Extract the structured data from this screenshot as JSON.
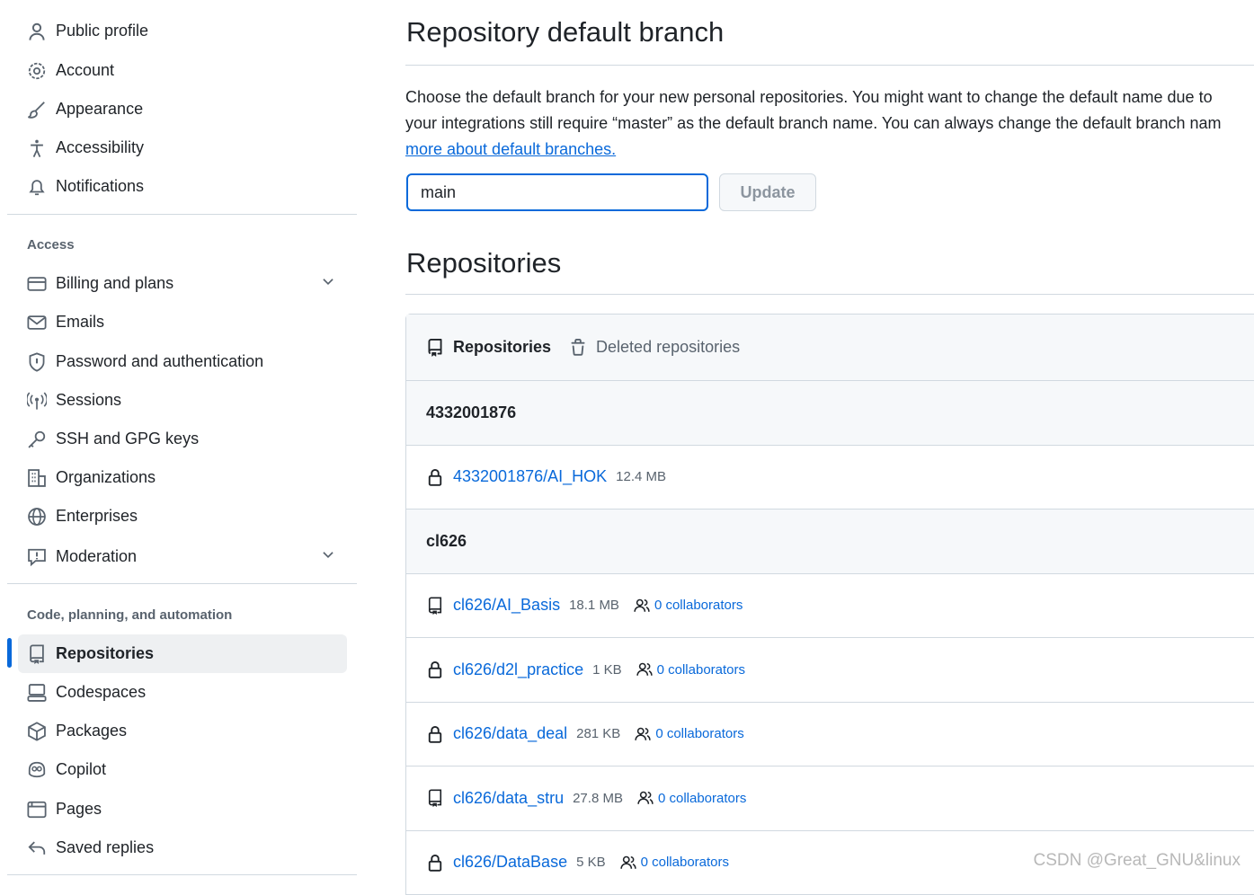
{
  "sidebar": {
    "items_top": [
      {
        "label": "Public profile",
        "icon": "person-icon"
      },
      {
        "label": "Account",
        "icon": "gear-icon"
      },
      {
        "label": "Appearance",
        "icon": "paintbrush-icon"
      },
      {
        "label": "Accessibility",
        "icon": "accessibility-icon"
      },
      {
        "label": "Notifications",
        "icon": "bell-icon"
      }
    ],
    "access_heading": "Access",
    "items_access": [
      {
        "label": "Billing and plans",
        "icon": "credit-card-icon",
        "expandable": true
      },
      {
        "label": "Emails",
        "icon": "mail-icon"
      },
      {
        "label": "Password and authentication",
        "icon": "shield-icon"
      },
      {
        "label": "Sessions",
        "icon": "broadcast-icon"
      },
      {
        "label": "SSH and GPG keys",
        "icon": "key-icon"
      },
      {
        "label": "Organizations",
        "icon": "organization-icon"
      },
      {
        "label": "Enterprises",
        "icon": "globe-icon"
      },
      {
        "label": "Moderation",
        "icon": "report-icon",
        "expandable": true
      }
    ],
    "code_heading": "Code, planning, and automation",
    "items_code": [
      {
        "label": "Repositories",
        "icon": "repo-icon",
        "selected": true
      },
      {
        "label": "Codespaces",
        "icon": "codespaces-icon"
      },
      {
        "label": "Packages",
        "icon": "package-icon"
      },
      {
        "label": "Copilot",
        "icon": "copilot-icon"
      },
      {
        "label": "Pages",
        "icon": "browser-icon"
      },
      {
        "label": "Saved replies",
        "icon": "reply-icon"
      }
    ]
  },
  "default_branch": {
    "title": "Repository default branch",
    "desc_line1": "Choose the default branch for your new personal repositories. You might want to change the default name due to",
    "desc_line2": "your integrations still require “master” as the default branch name. You can always change the default branch nam",
    "link": "more about default branches.",
    "input_value": "main",
    "update_label": "Update"
  },
  "repositories": {
    "title": "Repositories",
    "tabs": [
      "Repositories",
      "Deleted repositories"
    ],
    "groups": [
      {
        "owner": "4332001876",
        "repos": [
          {
            "name": "4332001876/AI_HOK",
            "size": "12.4 MB",
            "private": true
          }
        ]
      },
      {
        "owner": "cl626",
        "repos": [
          {
            "name": "cl626/AI_Basis",
            "size": "18.1 MB",
            "private": false,
            "collaborators": "0 collaborators"
          },
          {
            "name": "cl626/d2l_practice",
            "size": "1 KB",
            "private": true,
            "collaborators": "0 collaborators"
          },
          {
            "name": "cl626/data_deal",
            "size": "281 KB",
            "private": true,
            "collaborators": "0 collaborators"
          },
          {
            "name": "cl626/data_stru",
            "size": "27.8 MB",
            "private": false,
            "collaborators": "0 collaborators"
          },
          {
            "name": "cl626/DataBase",
            "size": "5 KB",
            "private": true,
            "collaborators": "0 collaborators"
          }
        ]
      }
    ]
  },
  "watermark": "CSDN @Great_GNU&linux",
  "colors": {
    "accent": "#0969da",
    "border": "#d1d9e0",
    "subtle_bg": "#f6f8fa"
  }
}
